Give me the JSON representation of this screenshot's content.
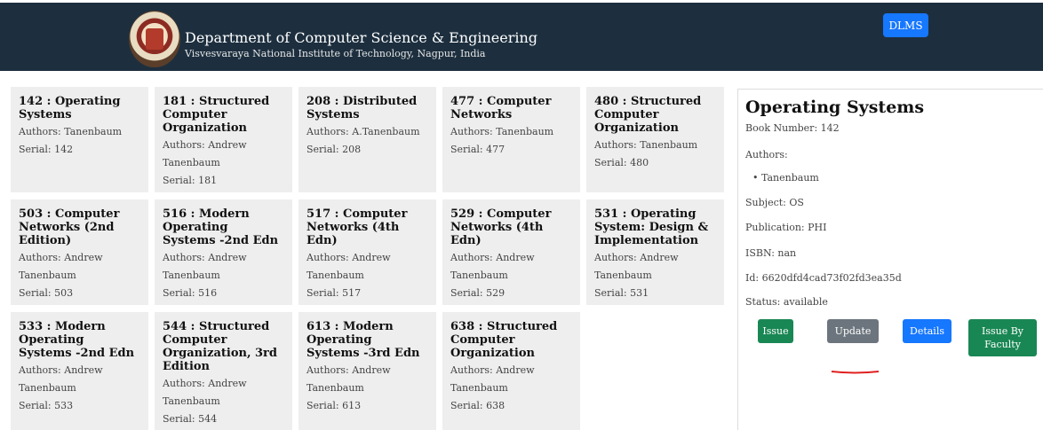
{
  "header": {
    "department": "Department of Computer Science & Engineering",
    "institute": "Visvesvaraya National Institute of Technology, Nagpur, India",
    "dlms_label": "DLMS"
  },
  "books": [
    {
      "title": "142 : Operating Systems",
      "authors": "Authors: Tanenbaum",
      "serial": "Serial: 142"
    },
    {
      "title": "181 : Structured Computer Organization",
      "authors": "Authors: Andrew Tanenbaum",
      "serial": "Serial: 181"
    },
    {
      "title": "208 : Distributed Systems",
      "authors": "Authors: A.Tanenbaum",
      "serial": "Serial: 208"
    },
    {
      "title": "477 : Computer Networks",
      "authors": "Authors: Tanenbaum",
      "serial": "Serial: 477"
    },
    {
      "title": "480 : Structured Computer Organization",
      "authors": "Authors: Tanenbaum",
      "serial": "Serial: 480"
    },
    {
      "title": "503 : Computer Networks (2nd Edition)",
      "authors": "Authors: Andrew Tanenbaum",
      "serial": "Serial: 503"
    },
    {
      "title": "516 : Modern Operating Systems -2nd Edn",
      "authors": "Authors: Andrew Tanenbaum",
      "serial": "Serial: 516"
    },
    {
      "title": "517 : Computer Networks (4th Edn)",
      "authors": "Authors: Andrew Tanenbaum",
      "serial": "Serial: 517"
    },
    {
      "title": "529 : Computer Networks (4th Edn)",
      "authors": "Authors: Andrew Tanenbaum",
      "serial": "Serial: 529"
    },
    {
      "title": "531 : Operating System: Design & Implementation",
      "authors": "Authors: Andrew Tanenbaum",
      "serial": "Serial: 531"
    },
    {
      "title": "533 : Modern Operating Systems -2nd Edn",
      "authors": "Authors: Andrew Tanenbaum",
      "serial": "Serial: 533"
    },
    {
      "title": "544 : Structured Computer Organization, 3rd Edition",
      "authors": "Authors: Andrew Tanenbaum",
      "serial": "Serial: 544"
    },
    {
      "title": "613 : Modern Operating Systems -3rd Edn",
      "authors": "Authors: Andrew Tanenbaum",
      "serial": "Serial: 613"
    },
    {
      "title": "638 : Structured Computer Organization",
      "authors": "Authors: Andrew Tanenbaum",
      "serial": "Serial: 638"
    }
  ],
  "detail": {
    "title": "Operating Systems",
    "book_number": "Book Number: 142",
    "authors_label": "Authors:",
    "authors": [
      "Tanenbaum"
    ],
    "subject": "Subject: OS",
    "publication": "Publication: PHI",
    "isbn": "ISBN: nan",
    "id": "Id: 6620dfd4cad73f02fd3ea35d",
    "status": "Status: available",
    "buttons": {
      "issue": "Issue",
      "update": "Update",
      "details": "Details",
      "issue_by_faculty": "Issue By Faculty"
    }
  },
  "colors": {
    "header_bg": "#1d2f3f",
    "primary": "#1677ff",
    "success": "#198754",
    "secondary": "#6c757d",
    "annotation": "#e02020"
  }
}
